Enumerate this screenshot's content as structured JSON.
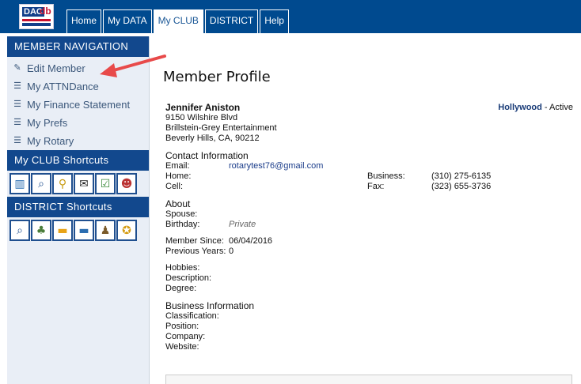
{
  "logo": {
    "text_main": "DAC",
    "text_accent": "db"
  },
  "tabs": [
    {
      "label": "Home",
      "active": false
    },
    {
      "label": "My DATA",
      "active": false
    },
    {
      "label": "My CLUB",
      "active": true
    },
    {
      "label": "DISTRICT",
      "active": false
    },
    {
      "label": "Help",
      "active": false
    }
  ],
  "sidebar": {
    "member_nav_title": "MEMBER NAVIGATION",
    "items": [
      {
        "label": "Edit Member",
        "icon": "edit-icon"
      },
      {
        "label": "My ATTNDance",
        "icon": "list-icon"
      },
      {
        "label": "My Finance Statement",
        "icon": "list-icon"
      },
      {
        "label": "My Prefs",
        "icon": "list-icon"
      },
      {
        "label": "My Rotary",
        "icon": "list-icon"
      }
    ],
    "club_shortcuts_title": "My CLUB Shortcuts",
    "district_shortcuts_title": "DISTRICT Shortcuts"
  },
  "main": {
    "page_title": "Member Profile",
    "member": {
      "name": "Jennifer Aniston",
      "address1": "9150 Wilshire Blvd",
      "address2": "Brillstein-Grey Entertainment",
      "address3": "Beverly Hills, CA, 90212",
      "club": "Hollywood",
      "status": "- Active"
    },
    "contact": {
      "title": "Contact Information",
      "email_label": "Email:",
      "email_value": "rotarytest76@gmail.com",
      "home_label": "Home:",
      "home_value": "",
      "cell_label": "Cell:",
      "cell_value": "",
      "business_label": "Business:",
      "business_value": "(310) 275-6135",
      "fax_label": "Fax:",
      "fax_value": "(323) 655-3736"
    },
    "about": {
      "title": "About",
      "spouse_label": "Spouse:",
      "birthday_label": "Birthday:",
      "birthday_value": "Private",
      "member_since_label": "Member Since:",
      "member_since_value": "06/04/2016",
      "previous_years_label": "Previous Years:",
      "previous_years_value": "0",
      "hobbies_label": "Hobbies:",
      "description_label": "Description:",
      "degree_label": "Degree:"
    },
    "business": {
      "title": "Business Information",
      "classification_label": "Classification:",
      "position_label": "Position:",
      "company_label": "Company:",
      "website_label": "Website:"
    }
  },
  "colors": {
    "topbar": "#004a8f",
    "sidebar_header": "#12488d",
    "sidebar_bg": "#e9eef6",
    "annotation_arrow": "#e84a4a"
  }
}
